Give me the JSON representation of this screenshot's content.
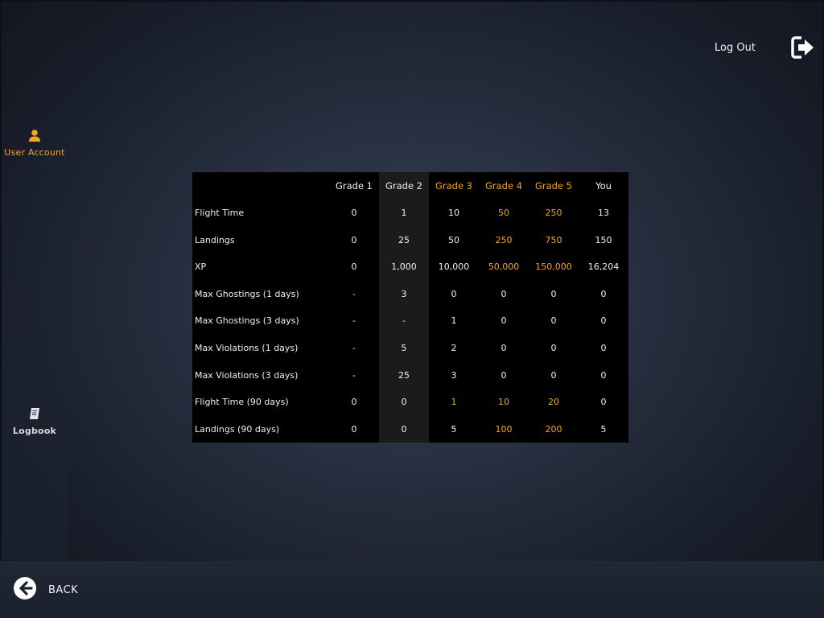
{
  "header": {
    "logout_label": "Log Out"
  },
  "sidebar": {
    "items": [
      {
        "label": "User Account",
        "icon": "user-icon",
        "active": true
      },
      {
        "label": "Logbook",
        "icon": "logbook-icon",
        "active": false
      }
    ]
  },
  "footer": {
    "back_label": "BACK"
  },
  "colors": {
    "accent": "#f5a623",
    "text": "#f0f0f0",
    "table_bg": "#000000",
    "grade2_bg": "#1b1b1b"
  },
  "table": {
    "columns": [
      "",
      "Grade 1",
      "Grade 2",
      "Grade 3",
      "Grade 4",
      "Grade 5",
      "You"
    ],
    "rows": [
      {
        "label": "Flight Time",
        "values": [
          "0",
          "1",
          "10",
          "50",
          "250",
          "13"
        ]
      },
      {
        "label": "Landings",
        "values": [
          "0",
          "25",
          "50",
          "250",
          "750",
          "150"
        ]
      },
      {
        "label": "XP",
        "values": [
          "0",
          "1,000",
          "10,000",
          "50,000",
          "150,000",
          "16,204"
        ]
      },
      {
        "label": "Max Ghostings (1 days)",
        "values": [
          "-",
          "3",
          "0",
          "0",
          "0",
          "0"
        ]
      },
      {
        "label": "Max Ghostings (3 days)",
        "values": [
          "-",
          "-",
          "1",
          "0",
          "0",
          "0"
        ]
      },
      {
        "label": "Max Violations (1 days)",
        "values": [
          "-",
          "5",
          "2",
          "0",
          "0",
          "0"
        ]
      },
      {
        "label": "Max Violations (3 days)",
        "values": [
          "-",
          "25",
          "3",
          "0",
          "0",
          "0"
        ]
      },
      {
        "label": "Flight Time (90 days)",
        "values": [
          "0",
          "0",
          "1",
          "10",
          "20",
          "0"
        ]
      },
      {
        "label": "Landings (90 days)",
        "values": [
          "0",
          "0",
          "5",
          "100",
          "200",
          "5"
        ]
      }
    ]
  }
}
